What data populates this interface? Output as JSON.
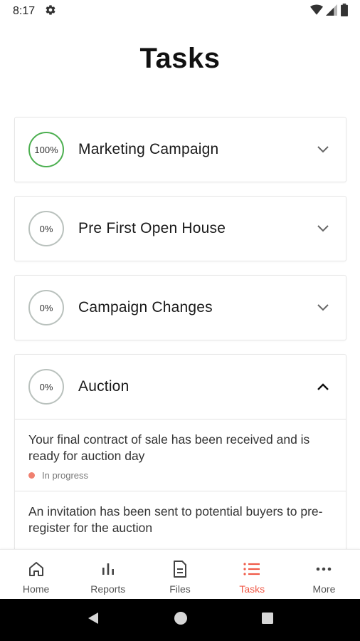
{
  "status_bar": {
    "time": "8:17"
  },
  "header": {
    "title": "Tasks"
  },
  "tasks": [
    {
      "progress": "100%",
      "title": "Marketing Campaign",
      "expanded": false
    },
    {
      "progress": "0%",
      "title": "Pre First Open House",
      "expanded": false
    },
    {
      "progress": "0%",
      "title": "Campaign Changes",
      "expanded": false
    },
    {
      "progress": "0%",
      "title": "Auction",
      "expanded": true,
      "subtasks": [
        {
          "text": "Your final contract of sale has been received and is ready for auction day",
          "status": "In progress"
        },
        {
          "text": "An invitation has been sent to potential buyers to pre-register for the auction"
        }
      ]
    }
  ],
  "bottom_nav": [
    {
      "label": "Home",
      "icon": "home-icon"
    },
    {
      "label": "Reports",
      "icon": "bar-chart-icon"
    },
    {
      "label": "Files",
      "icon": "file-icon"
    },
    {
      "label": "Tasks",
      "icon": "list-icon",
      "active": true
    },
    {
      "label": "More",
      "icon": "more-icon"
    }
  ],
  "colors": {
    "accent": "#f05a48",
    "complete": "#4caf50",
    "ring": "#b9c1bd",
    "in_progress_dot": "#f08070"
  }
}
